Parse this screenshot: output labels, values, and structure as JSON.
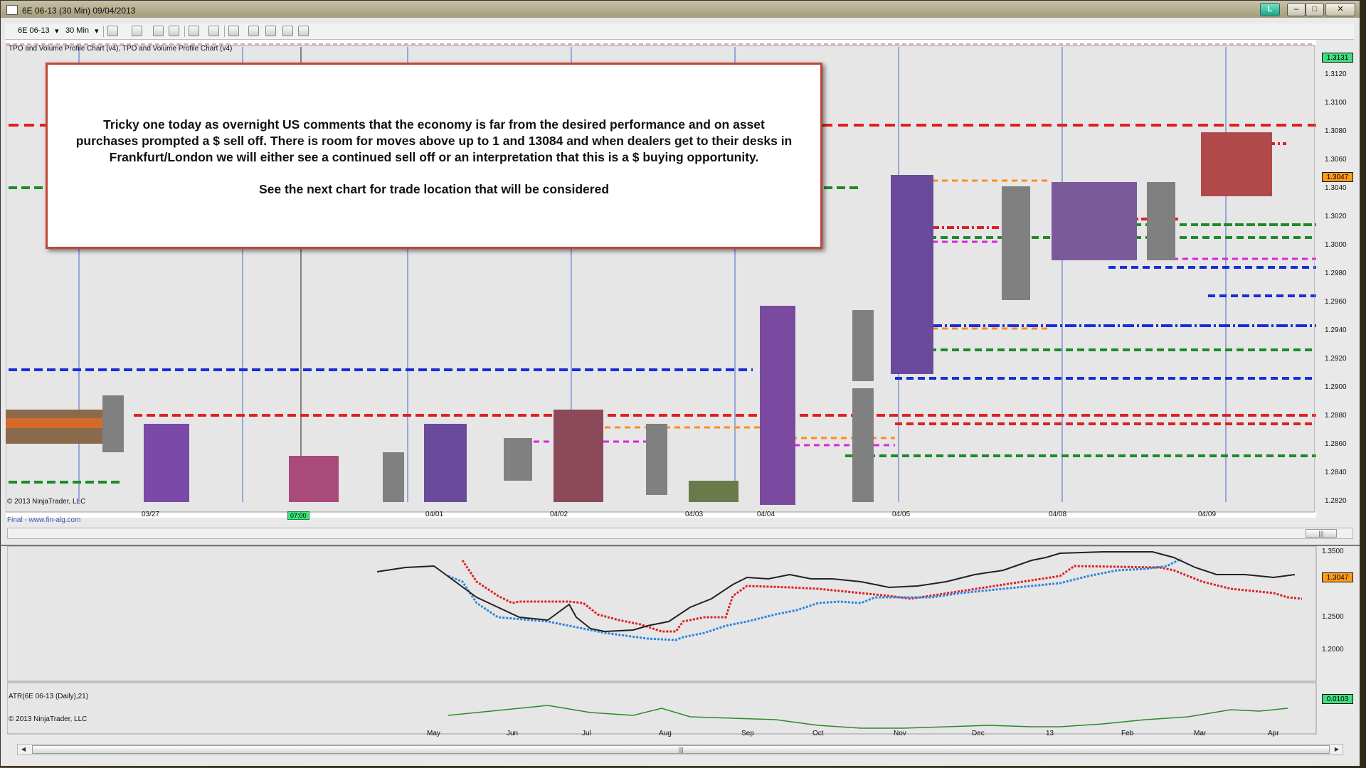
{
  "window": {
    "title": "6E 06-13 (30 Min)  09/04/2013",
    "link_button": "L",
    "minimize": "–",
    "maximize": "□",
    "close": "✕"
  },
  "toolbar": {
    "instrument": "6E 06-13",
    "interval": "30 Min"
  },
  "chart": {
    "legend": "TPO and Volume Profile Chart (v4),  TPO and Volume Profile Chart (v4)",
    "copyright": "© 2013 NinjaTrader, LLC",
    "footer_link": "Final - www.fin-alg.com",
    "current_price": "1.3047",
    "top_price": "1.3131",
    "time_badge": "07:00",
    "price_axis": [
      "1.3120",
      "1.3100",
      "1.3080",
      "1.3060",
      "1.3040",
      "1.3020",
      "1.3000",
      "1.2980",
      "1.2960",
      "1.2940",
      "1.2920",
      "1.2900",
      "1.2880",
      "1.2860",
      "1.2840",
      "1.2820"
    ],
    "date_axis": [
      "03/27",
      "04/01",
      "04/02",
      "04/03",
      "04/04",
      "04/05",
      "04/08",
      "04/09"
    ],
    "annotation": {
      "line1": "Tricky one today as overnight US comments that the economy is far from the desired performance and on asset",
      "line2": "purchases prompted a $ sell off.  There is room for moves above up to 1 and 13084 and when dealers get to their desks in",
      "line3": "Frankfurt/London we will either see a continued sell off or an interpretation that this is a $ buying opportunity.",
      "line4": "See the next chart for trade location that will be considered"
    }
  },
  "lower_chart": {
    "price_axis": [
      "1.3500",
      "1.2500",
      "1.2000"
    ],
    "current_price": "1.3047",
    "atr_label": "ATR(6E 06-13 (Daily),21)",
    "atr_value": "0.0103",
    "copyright": "© 2013 NinjaTrader, LLC",
    "month_axis": [
      "May",
      "Jun",
      "Jul",
      "Aug",
      "Sep",
      "Oct",
      "Nov",
      "Dec",
      "13",
      "Feb",
      "Mar",
      "Apr"
    ]
  },
  "colors": {
    "red_level": "#e02020",
    "green_level": "#1f8a2a",
    "blue_level": "#1a2ed8",
    "orange_level": "#ff8c1a",
    "magenta_level": "#e020e0",
    "accent_green": "#3ee07c"
  },
  "icons": [
    "app-icon",
    "dropdown-icon",
    "chart-style-icon",
    "draw-tool-icon",
    "crosshair-icon",
    "zoom-icon",
    "properties-icon",
    "strategy-icon",
    "bar-icon",
    "data-box-icon"
  ]
}
